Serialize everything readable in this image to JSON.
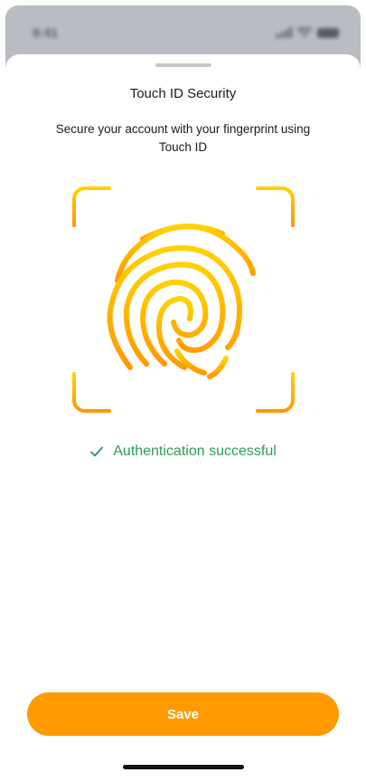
{
  "status_bar": {
    "time": "9:41",
    "signal_icon": "signal-icon",
    "wifi_icon": "wifi-icon",
    "battery_icon": "battery-icon"
  },
  "sheet": {
    "title": "Touch ID Security",
    "subtitle": "Secure your account with your fingerprint using Touch ID",
    "scanner_icon": "fingerprint-icon",
    "auth_status": {
      "icon": "checkmark-icon",
      "text": "Authentication successful",
      "color": "#2a9d57"
    },
    "save_button": {
      "label": "Save",
      "color": "#ff9a00"
    }
  },
  "colors": {
    "accent_gradient_top": "#ffd200",
    "accent_gradient_bottom": "#ff9800"
  }
}
